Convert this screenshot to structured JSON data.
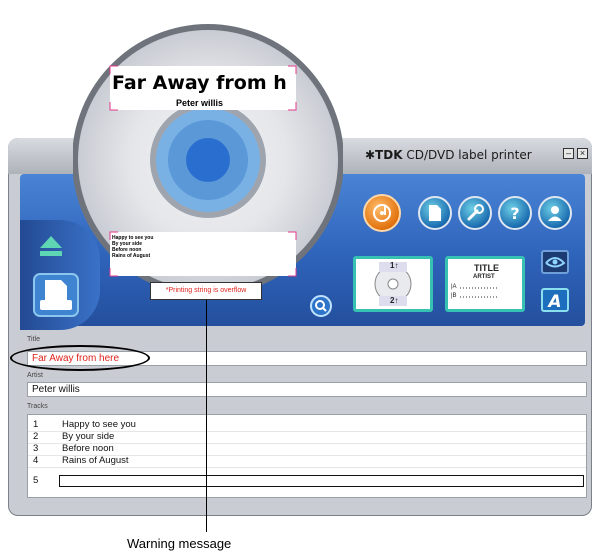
{
  "app": {
    "brand": "✱TDK",
    "title": "CD/DVD label printer",
    "minimize_icon": "minimize-icon",
    "close_icon": "close-icon"
  },
  "disc_preview": {
    "title_text": "Far Away from h",
    "artist_text": "Peter willis",
    "tracks_text": [
      "Happy to see you",
      "By your side",
      "Before noon",
      "Rains of August"
    ],
    "warning_text": "*Printing string is overflow"
  },
  "toolbar": {
    "icons": [
      "label-design-icon",
      "document-icon",
      "wrench-icon",
      "help-icon",
      "user-icon"
    ],
    "layout_thumb_1": {
      "top": "1↑",
      "bottom": "2↑"
    },
    "layout_thumb_2": {
      "title": "TITLE",
      "artist": "ARTIST",
      "a": "|A",
      "b": "|B"
    },
    "side_icons": [
      "eye-icon",
      "text-icon"
    ],
    "left_icons": [
      "eject-icon",
      "print-icon"
    ],
    "zoom_icon": "zoom-icon"
  },
  "form": {
    "title_label": "Title",
    "title_value": "Far Away from here",
    "title_color": "#e0241c",
    "artist_label": "Artist",
    "artist_value": "Peter willis",
    "tracks_label": "Tracks",
    "tracks": [
      {
        "num": "1",
        "name": "Happy to see you"
      },
      {
        "num": "2",
        "name": "By your side"
      },
      {
        "num": "3",
        "name": "Before noon"
      },
      {
        "num": "4",
        "name": "Rains of August"
      },
      {
        "num": "5",
        "name": ""
      }
    ]
  },
  "callout": {
    "label": "Warning message"
  }
}
